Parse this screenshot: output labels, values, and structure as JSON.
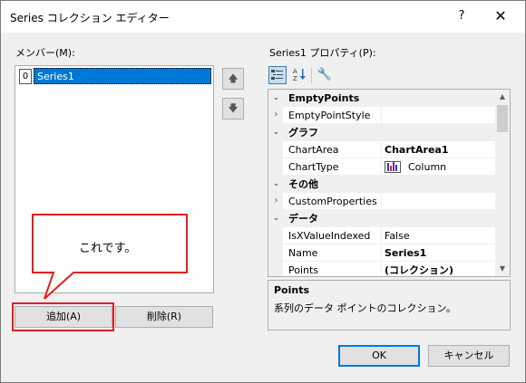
{
  "window": {
    "title": "Series コレクション エディター",
    "help_glyph": "?",
    "close_glyph": "✕"
  },
  "members": {
    "label": "メンバー(M):",
    "items": [
      {
        "index": "0",
        "name": "Series1"
      }
    ]
  },
  "properties": {
    "label": "Series1 プロパティ(P):",
    "rows": [
      {
        "kind": "category",
        "name": "EmptyPoints"
      },
      {
        "kind": "prop",
        "name": "EmptyPointStyle",
        "value": "",
        "expandable": true
      },
      {
        "kind": "category",
        "name": "グラフ"
      },
      {
        "kind": "prop",
        "name": "ChartArea",
        "value": "ChartArea1",
        "bold": true
      },
      {
        "kind": "prop",
        "name": "ChartType",
        "value": "Column",
        "icon": "column-chart-icon"
      },
      {
        "kind": "category",
        "name": "その他"
      },
      {
        "kind": "prop",
        "name": "CustomProperties",
        "value": "",
        "expandable": true
      },
      {
        "kind": "category",
        "name": "データ"
      },
      {
        "kind": "prop",
        "name": "IsXValueIndexed",
        "value": "False"
      },
      {
        "kind": "prop",
        "name": "Name",
        "value": "Series1",
        "bold": true
      },
      {
        "kind": "prop",
        "name": "Points",
        "value": "(コレクション)",
        "bold": true
      }
    ]
  },
  "description": {
    "title": "Points",
    "text": "系列のデータ ポイントのコレクション。"
  },
  "buttons": {
    "add": "追加(A)",
    "remove": "削除(R)",
    "ok": "OK",
    "cancel": "キャンセル",
    "move_up": "🡅",
    "move_down": "🡇"
  },
  "annotation": {
    "callout_text": "これです。",
    "highlight_color": "#e0201b"
  },
  "colors": {
    "selection": "#0078d7",
    "dialog_bg": "#f0f0f0"
  }
}
